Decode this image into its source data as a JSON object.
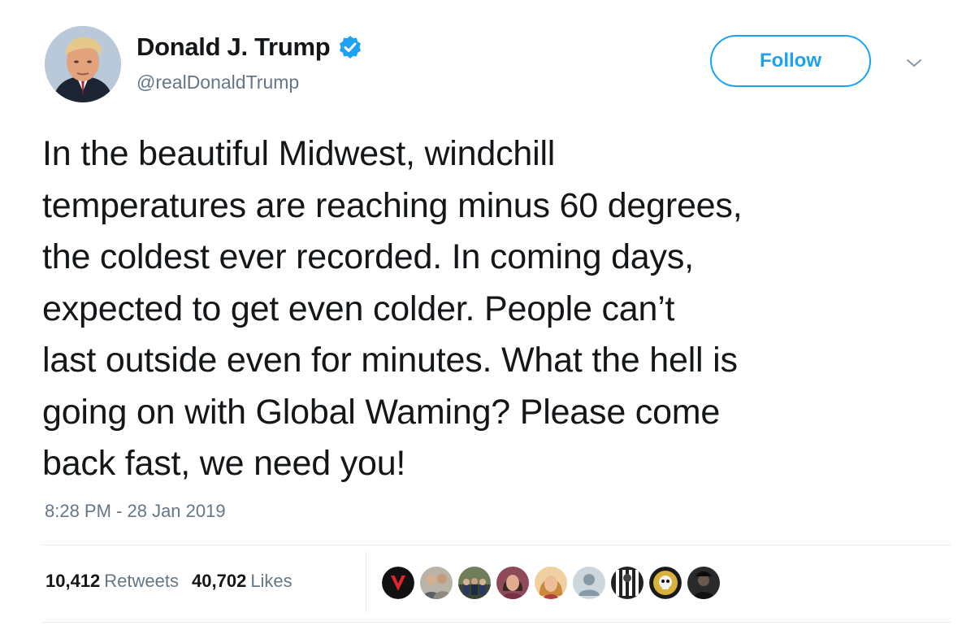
{
  "author": {
    "display_name": "Donald J. Trump",
    "handle": "@realDonaldTrump",
    "verified": true
  },
  "actions": {
    "follow_label": "Follow"
  },
  "tweet": {
    "text": "In the beautiful Midwest, windchill\ntemperatures are reaching minus 60 degrees,\nthe coldest ever recorded. In coming days,\nexpected to get even colder. People can’t\nlast outside even for minutes. What the hell is\ngoing on with Global Waming? Please come\nback fast, we need you!",
    "timestamp": "8:28 PM - 28 Jan 2019"
  },
  "stats": {
    "retweets_count": "10,412",
    "retweets_label": "Retweets",
    "likes_count": "40,702",
    "likes_label": "Likes"
  },
  "likers": [
    {
      "icon": "v-logo-avatar",
      "color": "#111111"
    },
    {
      "icon": "couple-avatar",
      "color": "#8e8a7f"
    },
    {
      "icon": "group-avatar",
      "color": "#4a5a3c"
    },
    {
      "icon": "woman-avatar",
      "color": "#a06a66"
    },
    {
      "icon": "blonde-woman-avatar",
      "color": "#d9a36a"
    },
    {
      "icon": "default-avatar",
      "color": "#c7d1da"
    },
    {
      "icon": "flag-avatar",
      "color": "#333333"
    },
    {
      "icon": "skull-badge-avatar",
      "color": "#c9a227"
    },
    {
      "icon": "dark-photo-avatar",
      "color": "#222222"
    }
  ],
  "colors": {
    "brand_blue": "#1da1f2",
    "secondary_text": "#657786",
    "primary_text": "#14171a"
  }
}
